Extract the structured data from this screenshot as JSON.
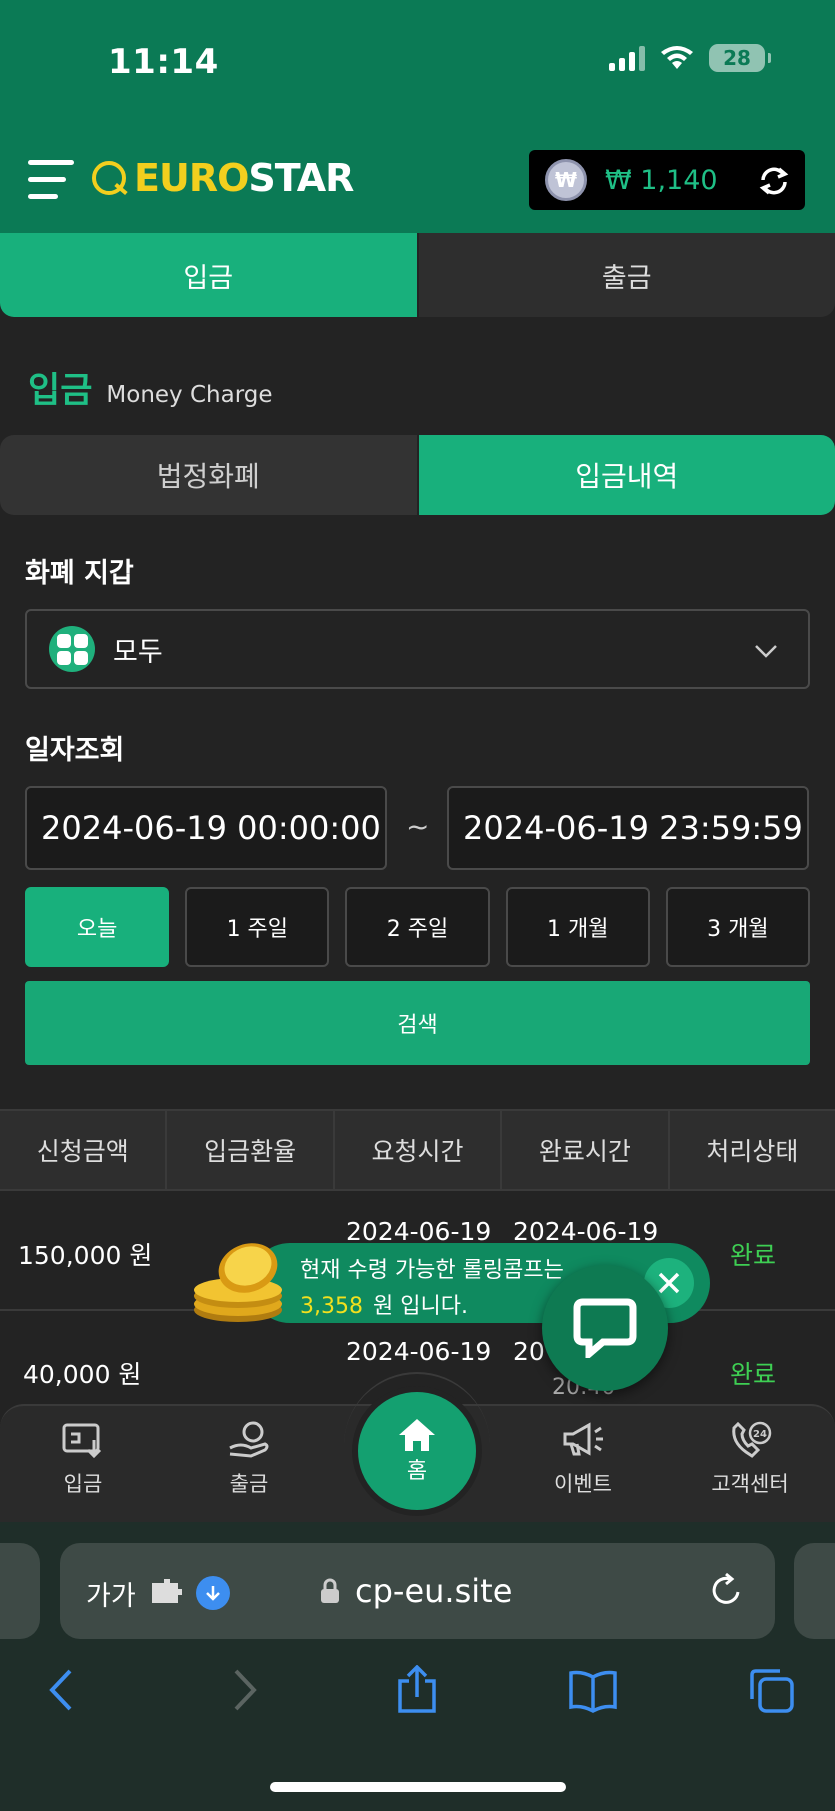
{
  "status_bar": {
    "time": "11:14",
    "battery": "28"
  },
  "header": {
    "logo_euro": "EURO",
    "logo_star": "STAR",
    "balance_symbol": "₩",
    "balance": "₩ 1,140"
  },
  "main_tabs": [
    {
      "label": "입금",
      "active": true
    },
    {
      "label": "출금",
      "active": false
    }
  ],
  "section": {
    "title_ko": "입금",
    "title_en": "Money Charge"
  },
  "sub_tabs": [
    {
      "label": "법정화폐",
      "active": false
    },
    {
      "label": "입금내역",
      "active": true
    }
  ],
  "wallet": {
    "label": "화폐 지갑",
    "selected": "모두"
  },
  "date_query": {
    "label": "일자조회",
    "from": "2024-06-19 00:00:00",
    "separator": "~",
    "to": "2024-06-19 23:59:59"
  },
  "range_buttons": [
    {
      "label": "오늘",
      "active": true
    },
    {
      "label": "1 주일",
      "active": false
    },
    {
      "label": "2 주일",
      "active": false
    },
    {
      "label": "1 개월",
      "active": false
    },
    {
      "label": "3 개월",
      "active": false
    }
  ],
  "search_button": "검색",
  "table": {
    "headers": [
      "신청금액",
      "입금환율",
      "요청시간",
      "완료시간",
      "처리상태"
    ],
    "rows": [
      {
        "amount": "150,000 원",
        "request": "2024-06-19",
        "complete": "2024-06-19",
        "status": "완료"
      },
      {
        "amount": "40,000 원",
        "request": "2024-06-19",
        "complete": "20",
        "complete2": "20:40",
        "status": "완료"
      }
    ]
  },
  "banner": {
    "line1": "현재 수령 가능한 롤링콤프는",
    "amount": "3,358",
    "line2_suffix": "원 입니다."
  },
  "bottom_nav": [
    {
      "label": "입금",
      "icon": "deposit-icon"
    },
    {
      "label": "출금",
      "icon": "withdraw-icon"
    },
    {
      "label": "홈",
      "icon": "home-icon"
    },
    {
      "label": "이벤트",
      "icon": "megaphone-icon"
    },
    {
      "label": "고객센터",
      "icon": "support-24-icon"
    }
  ],
  "browser": {
    "aa_label": "가가",
    "url": "cp-eu.site"
  },
  "colors": {
    "accent": "#18b07c",
    "header": "#0b7a55",
    "gold": "#f2cf1e",
    "status": "#3ecf53"
  }
}
